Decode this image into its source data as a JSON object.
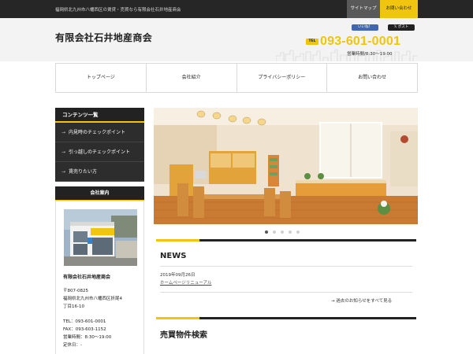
{
  "topbar": {
    "tagline": "福岡県北九州市八幡西区の賃貸・売買なら有限会社石井地産商会",
    "sitemap": "サイトマップ",
    "contact": "お問い合わせ"
  },
  "header": {
    "logo": "有限会社石井地産商会",
    "sns_like": "いいね！",
    "sns_post": "ポスト",
    "tel_label": "TEL",
    "tel_number": "093-601-0001",
    "hours": "営業時間/8:30〜19:00"
  },
  "nav": {
    "items": [
      {
        "label": "トップページ"
      },
      {
        "label": "会社紹介"
      },
      {
        "label": "プライバシーポリシー"
      },
      {
        "label": "お問い合わせ"
      }
    ]
  },
  "sidebar": {
    "title": "コンテンツ一覧",
    "items": [
      {
        "label": "内見時のチェックポイント"
      },
      {
        "label": "引っ越しのチェックポイント"
      },
      {
        "label": "賃売りたい方"
      }
    ],
    "company_title": "会社案内",
    "company_name": "有限会社石井地産商会",
    "company_lines": [
      "〒807-0825",
      "福岡県北九州市八幡西区折尾4",
      "丁目16-10",
      "",
      "TEL：093-601-0001",
      "FAX：093-603-1152",
      "営業時間：8:30～19:00",
      "定休日：-"
    ]
  },
  "main": {
    "news_heading": "NEWS",
    "news": [
      {
        "date": "2019年09月26日",
        "title": "ホームページリニューアル"
      }
    ],
    "news_more": "過去のお知らせをすべて見る",
    "search_heading": "売買物件検索",
    "slider_active": 1,
    "slider_count": 5
  },
  "colors": {
    "accent": "#f1c40f",
    "dark": "#222222"
  }
}
